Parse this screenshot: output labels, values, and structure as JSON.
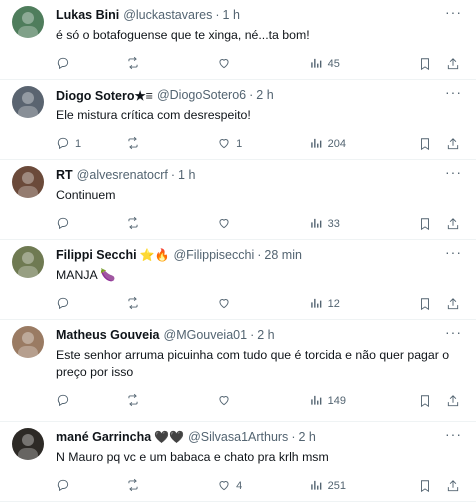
{
  "tweets": [
    {
      "name": "Lukas Bini",
      "handle": "@luckastavares",
      "time": "1 h",
      "badge": "",
      "text": "é só o botafoguense que te xinga, né...ta bom!",
      "replies": "",
      "retweets": "",
      "likes": "",
      "views": "45",
      "avatar_color": "#4f7d5c"
    },
    {
      "name": "Diogo Sotero★≡",
      "handle": "@DiogoSotero6",
      "time": "2 h",
      "badge": "",
      "text": "Ele mistura crítica com desrespeito!",
      "replies": "1",
      "retweets": "",
      "likes": "1",
      "views": "204",
      "avatar_color": "#5a6470"
    },
    {
      "name": "RT",
      "handle": "@alvesrenatocrf",
      "time": "1 h",
      "badge": "",
      "text": "Continuem",
      "replies": "",
      "retweets": "",
      "likes": "",
      "views": "33",
      "avatar_color": "#6b4a3a"
    },
    {
      "name": "Filippi Secchi",
      "handle": "@Filippisecchi",
      "time": "28 min",
      "badge": "⭐🔥",
      "text": "MANJA 🍆",
      "replies": "",
      "retweets": "",
      "likes": "",
      "views": "12",
      "avatar_color": "#6f7a52"
    },
    {
      "name": "Matheus Gouveia",
      "handle": "@MGouveia01",
      "time": "2 h",
      "badge": "",
      "text": "Este senhor arruma picuinha com tudo que é torcida e não quer pagar o preço por isso",
      "replies": "",
      "retweets": "",
      "likes": "",
      "views": "149",
      "avatar_color": "#9a7b63"
    },
    {
      "name": "mané Garrincha",
      "handle": "@Silvasa1Arthurs",
      "time": "2 h",
      "badge": "🖤🖤",
      "text": "N Mauro pq vc e um babaca e chato pra krlh msm",
      "replies": "",
      "retweets": "",
      "likes": "4",
      "views": "251",
      "avatar_color": "#2d2a26"
    }
  ],
  "icons": [
    "reply-icon",
    "retweet-icon",
    "like-icon",
    "views-icon",
    "bookmark-icon",
    "share-icon",
    "more-icon"
  ]
}
